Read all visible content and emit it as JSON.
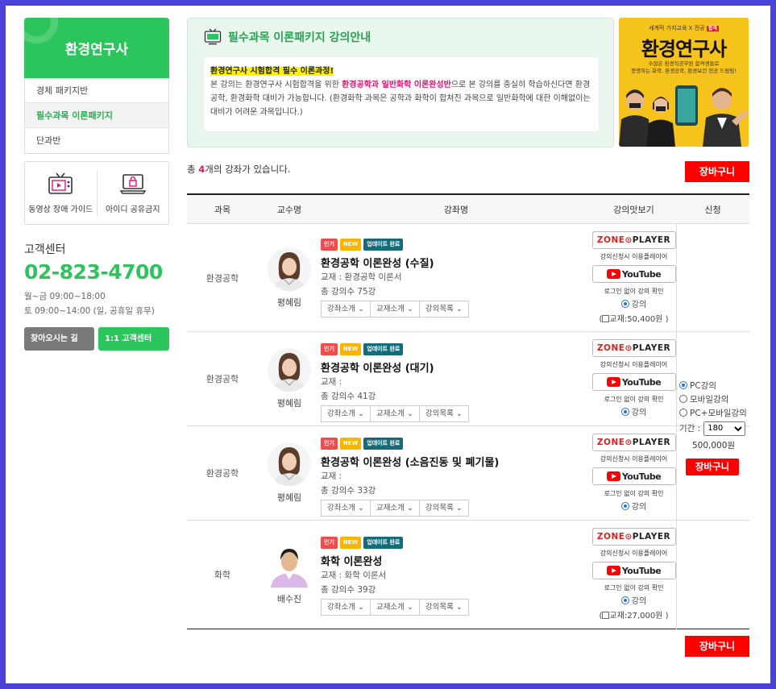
{
  "sidebar": {
    "title": "환경연구사",
    "menu": [
      "경체 패키지반",
      "필수과목 이론패키지",
      "단과반"
    ],
    "active_index": 1,
    "quick": [
      "동영상 장애 가이드",
      "아이디 공유금지"
    ],
    "cs_title": "고객센터",
    "cs_phone": "02-823-4700",
    "cs_hours_1": "월~금 09:00~18:00",
    "cs_hours_2": "토 09:00~14:00 (일, 공휴일 휴무)",
    "btn_location": "찾아오시는 길",
    "btn_cs": "1:1 고객센터"
  },
  "notice": {
    "title": "필수과목 이론패키지 강의안내",
    "highlight": "환경연구사 시험합격 필수 이론과정!",
    "text_a": "본 강의는 환경연구사 시험합격을 위한 ",
    "text_pink": "환경공학과 일반화학 이론완성반",
    "text_b": "으로 본 강의를 충실히 학습하신다면 환경공학, 환경화학 대비가 가능합니다. (환경화학 과목은 공학과 화학이 합쳐진 과목으로 일반화학에 대한 이해없이는 대비가 어려운 과목입니다.)"
  },
  "banner": {
    "brand_left": "세계적 가치교육",
    "brand_x": "X",
    "brand_right": "전공",
    "brand_badge": "합격",
    "title": "환경연구사",
    "sub_1": "수많은 환경직공무원 합격생들로",
    "sub_2": "증명하는 화학, 환경공학, 환경보건 전공 드림팀!"
  },
  "count": {
    "prefix": "총 ",
    "number": "4",
    "suffix": "개의 강좌가 있습니다."
  },
  "cart_label": "장바구니",
  "table": {
    "headers": [
      "과목",
      "교수명",
      "강좌명",
      "강의맛보기",
      "신청"
    ],
    "badges": [
      "인기",
      "NEW",
      "업데이트 완료"
    ],
    "dropdowns": [
      "강좌소개",
      "교재소개",
      "강의목록"
    ],
    "zone_left": "ZONE",
    "zone_right": "PLAYER",
    "preview_note": "강의신청시 이용플레이어",
    "youtube": "YouTube",
    "login_note": "로그인 없이 강의 확인",
    "radio_label": "강의",
    "rows": [
      {
        "subject": "환경공학",
        "professor": "평혜림",
        "title": "환경공학 이론완성 (수질)",
        "book": "교재 : 환경공학 이론서",
        "lectures": "총 강의수 75강",
        "book_price": "교재:50,400원"
      },
      {
        "subject": "환경공학",
        "professor": "평혜림",
        "title": "환경공학 이론완성 (대기)",
        "book": "교재 :",
        "lectures": "총 강의수 41강",
        "book_price": ""
      },
      {
        "subject": "환경공학",
        "professor": "평혜림",
        "title": "환경공학 이론완성 (소음진동 및 폐기물)",
        "book": "교재 :",
        "lectures": "총 강의수 33강",
        "book_price": ""
      },
      {
        "subject": "화학",
        "professor": "배수진",
        "title": "화학 이론완성",
        "book": "교재 : 화학 이론서",
        "lectures": "총 강의수 39강",
        "book_price": "교재:27,000원"
      }
    ]
  },
  "apply": {
    "options": [
      "PC강의",
      "모바일강의",
      "PC+모바일강의"
    ],
    "selected_index": 0,
    "period_label": "기간 :",
    "period_value": "180",
    "price": "500,000원",
    "cart": "장바구니"
  },
  "colors": {
    "accent": "#2cc45c",
    "cart": "#ff0000",
    "pink": "#e8116f",
    "frame": "#4a43d6"
  }
}
